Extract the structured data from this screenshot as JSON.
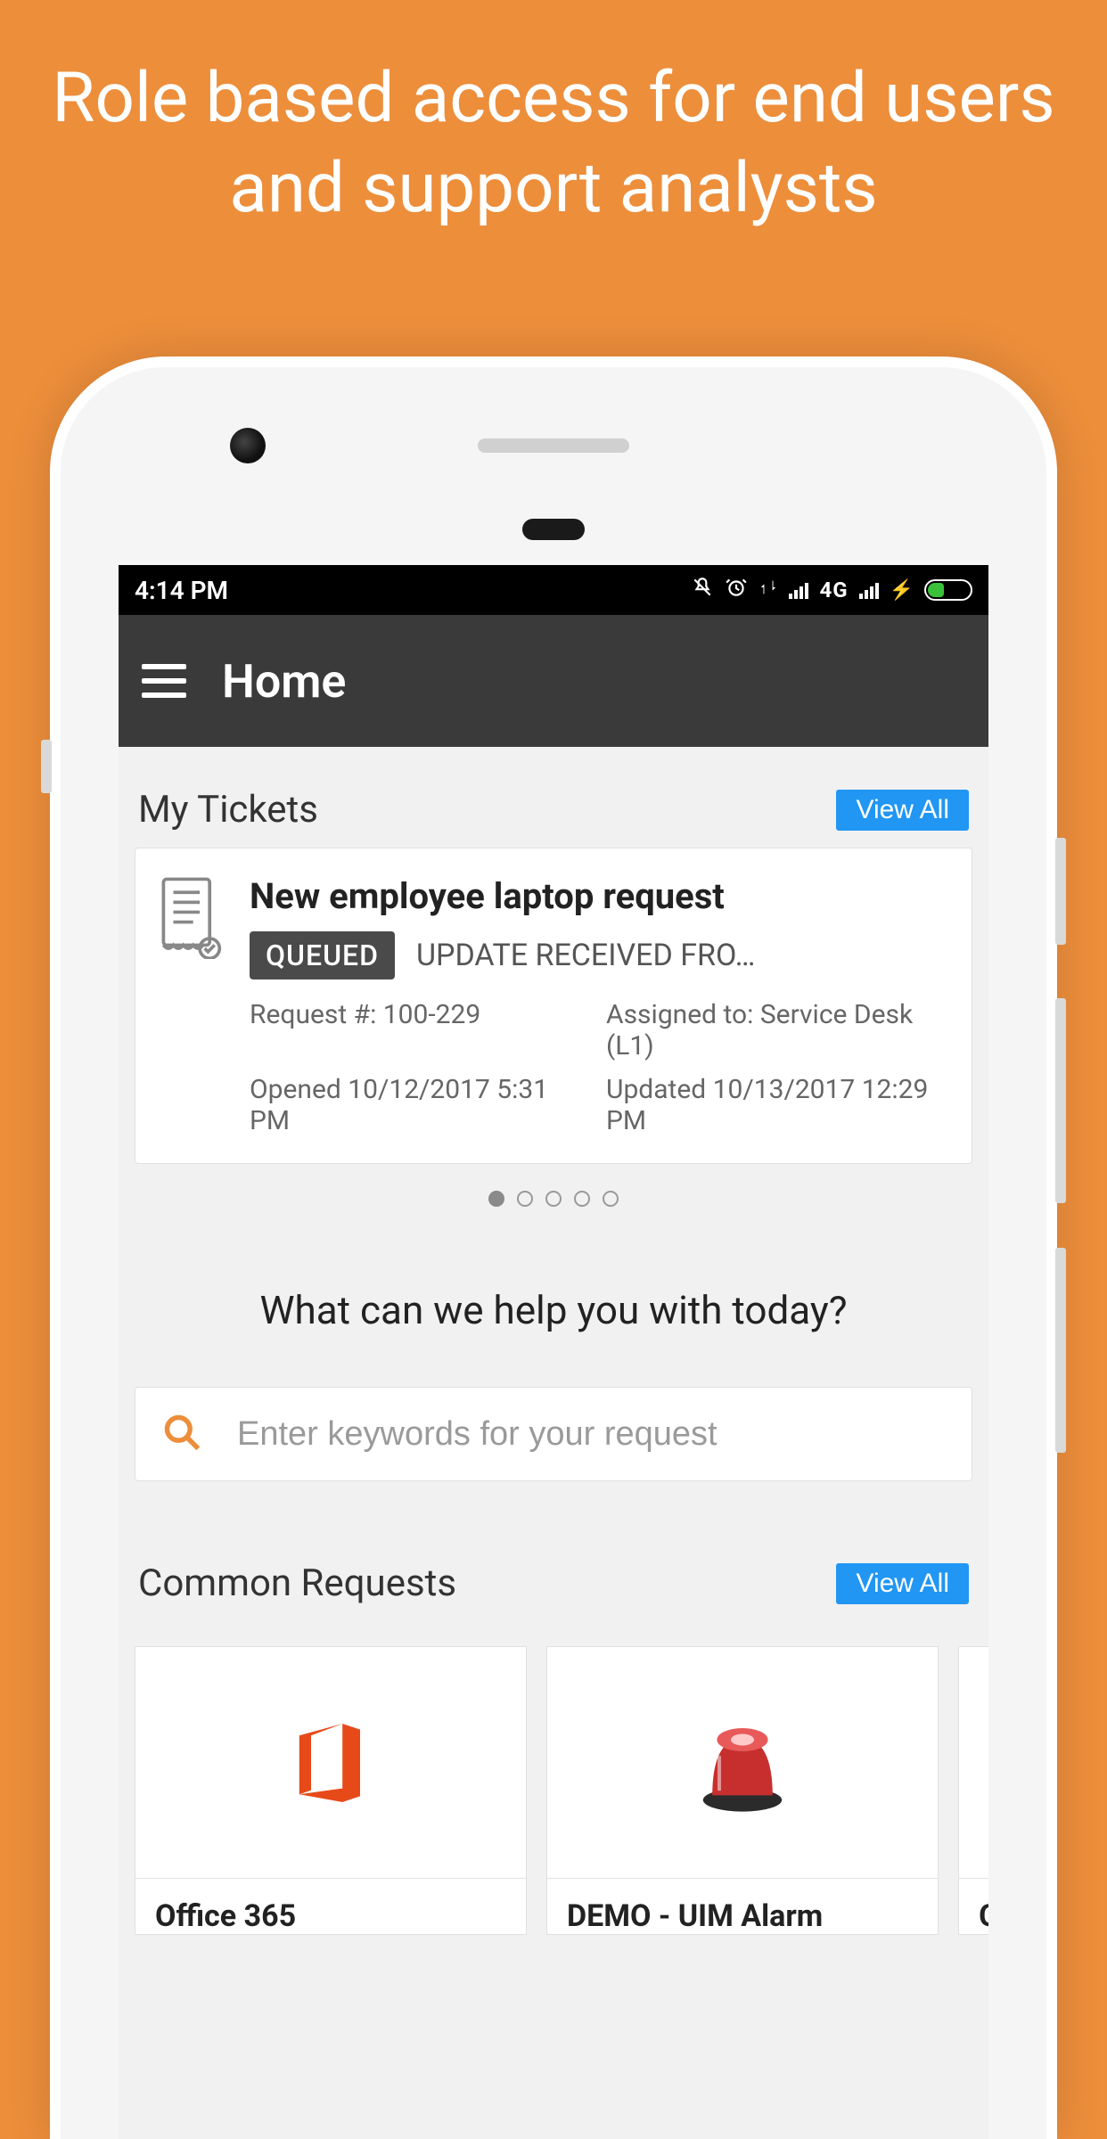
{
  "promo": "Role based access for end users and support analysts",
  "status": {
    "time": "4:14 PM",
    "network": "4G"
  },
  "appbar": {
    "title": "Home"
  },
  "tickets": {
    "section_title": "My Tickets",
    "view_all": "View All",
    "card": {
      "title": "New employee laptop request",
      "badge": "QUEUED",
      "status_text": "UPDATE RECEIVED FRO…",
      "request_no": "Request #: 100-229",
      "assigned": "Assigned to: Service Desk (L1)",
      "opened": "Opened 10/12/2017 5:31 PM",
      "updated": "Updated 10/13/2017 12:29 PM"
    },
    "pager_count": 5,
    "pager_active": 0
  },
  "help": {
    "prompt": "What can we help you with today?"
  },
  "search": {
    "placeholder": "Enter keywords for your request"
  },
  "common": {
    "section_title": "Common Requests",
    "view_all": "View All",
    "items": [
      {
        "label": "Office 365"
      },
      {
        "label": "DEMO - UIM Alarm"
      },
      {
        "label": "Goo"
      }
    ]
  }
}
